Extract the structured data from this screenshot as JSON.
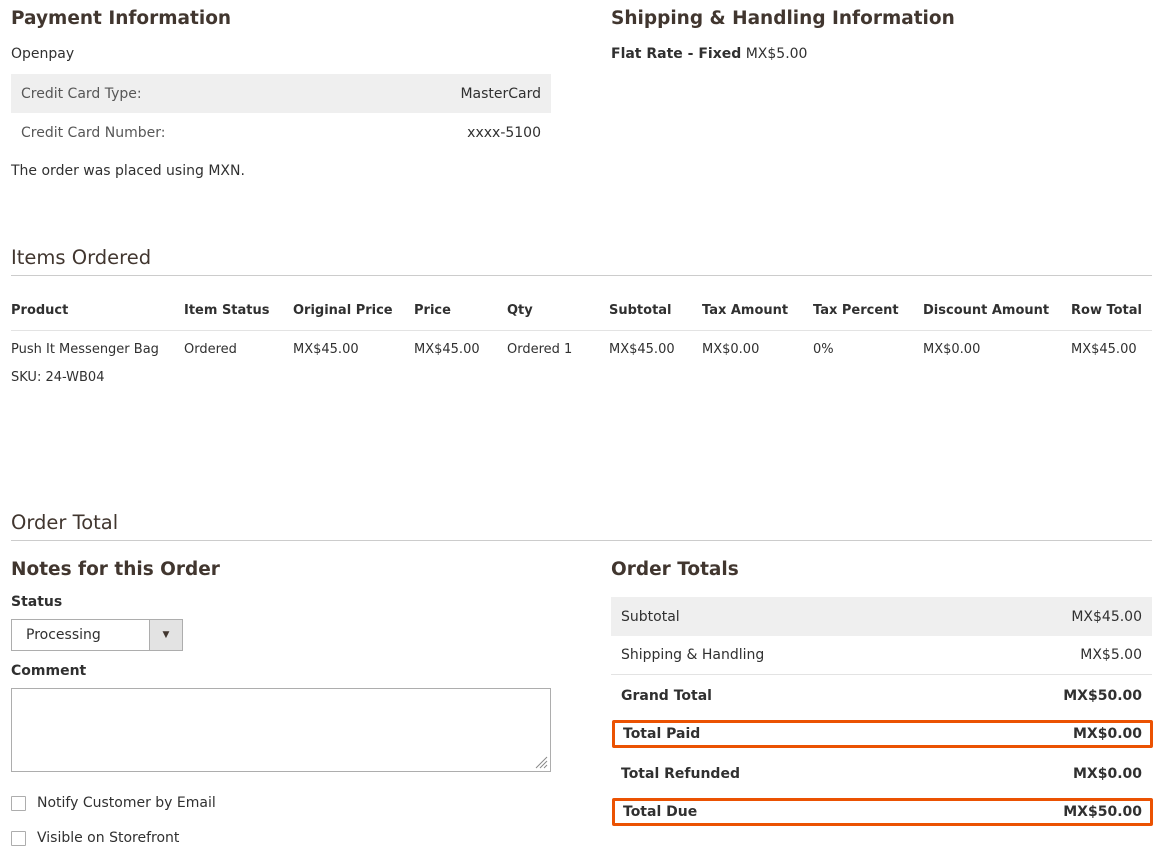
{
  "payment": {
    "title": "Payment Information",
    "method": "Openpay",
    "rows": [
      {
        "label": "Credit Card Type:",
        "value": "MasterCard"
      },
      {
        "label": "Credit Card Number:",
        "value": "xxxx-5100"
      }
    ],
    "currency_note": "The order was placed using MXN."
  },
  "shipping": {
    "title": "Shipping & Handling Information",
    "method_label": "Flat Rate - Fixed",
    "method_price": "MX$5.00"
  },
  "items": {
    "title": "Items Ordered",
    "columns": [
      "Product",
      "Item Status",
      "Original Price",
      "Price",
      "Qty",
      "Subtotal",
      "Tax Amount",
      "Tax Percent",
      "Discount Amount",
      "Row Total"
    ],
    "rows": [
      {
        "product": "Push It Messenger Bag",
        "sku": "SKU: 24-WB04",
        "status": "Ordered",
        "original_price": "MX$45.00",
        "price": "MX$45.00",
        "qty": "Ordered 1",
        "subtotal": "MX$45.00",
        "tax_amount": "MX$0.00",
        "tax_percent": "0%",
        "discount_amount": "MX$0.00",
        "row_total": "MX$45.00"
      }
    ]
  },
  "order_total": {
    "title": "Order Total",
    "notes": {
      "title": "Notes for this Order",
      "status_label": "Status",
      "status_value": "Processing",
      "comment_label": "Comment",
      "comment_value": "",
      "notify_label": "Notify Customer by Email",
      "notify_checked": false,
      "visible_label": "Visible on Storefront",
      "visible_checked": false
    },
    "totals": {
      "title": "Order Totals",
      "rows": [
        {
          "label": "Subtotal",
          "value": "MX$45.00"
        },
        {
          "label": "Shipping & Handling",
          "value": "MX$5.00"
        },
        {
          "label": "Grand Total",
          "value": "MX$50.00"
        },
        {
          "label": "Total Paid",
          "value": "MX$0.00"
        },
        {
          "label": "Total Refunded",
          "value": "MX$0.00"
        },
        {
          "label": "Total Due",
          "value": "MX$50.00"
        }
      ],
      "highlight_color": "#eb5202"
    }
  },
  "icons": {
    "select_arrow": "chevron-down-icon",
    "resize_grip": "resize-grip-icon"
  }
}
